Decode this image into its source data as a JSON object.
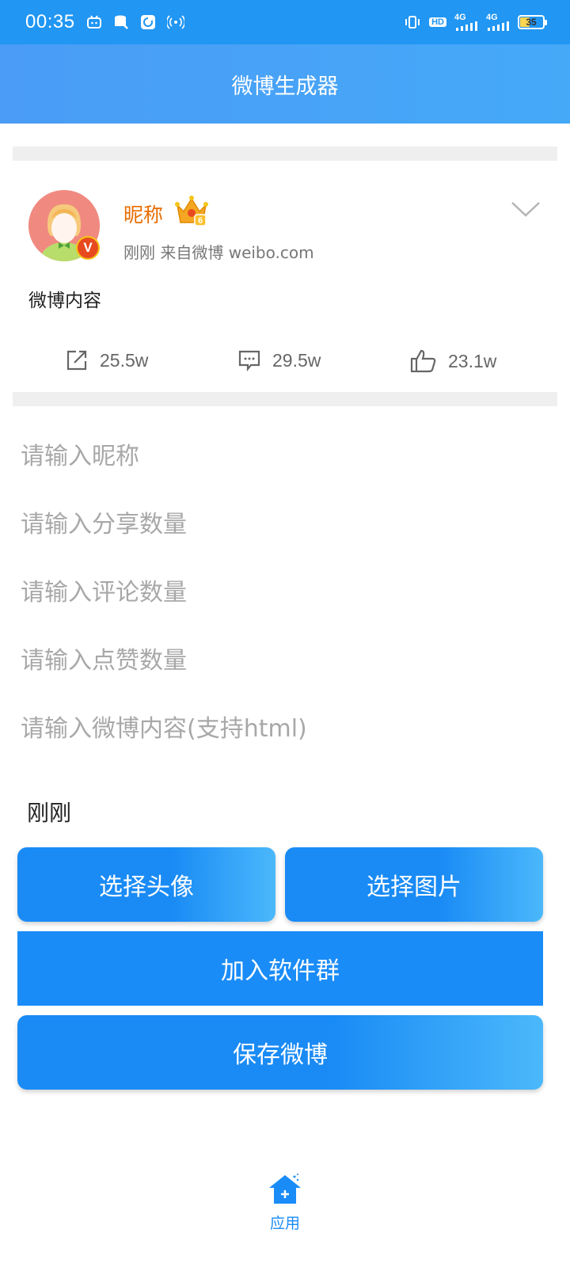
{
  "status_bar": {
    "time": "00:35",
    "battery_level": "35",
    "network_labels": [
      "HD",
      "4G",
      "4G"
    ]
  },
  "header": {
    "title": "微博生成器"
  },
  "post": {
    "nickname": "昵称",
    "meta": "刚刚  来自微博 weibo.com",
    "content": "微博内容",
    "vip_level": "6",
    "verified_mark": "V",
    "shares": "25.5w",
    "comments": "29.5w",
    "likes": "23.1w"
  },
  "form": {
    "nickname_placeholder": "请输入昵称",
    "shares_placeholder": "请输入分享数量",
    "comments_placeholder": "请输入评论数量",
    "likes_placeholder": "请输入点赞数量",
    "content_placeholder": "请输入微博内容(支持html)",
    "time_value": "刚刚"
  },
  "buttons": {
    "choose_avatar": "选择头像",
    "choose_image": "选择图片",
    "join_group": "加入软件群",
    "save_post": "保存微博"
  },
  "bottom_nav": {
    "app_label": "应用"
  },
  "colors": {
    "status_bar": "#2196f3",
    "accent": "#1a8cf7",
    "nickname": "#e86c00"
  }
}
